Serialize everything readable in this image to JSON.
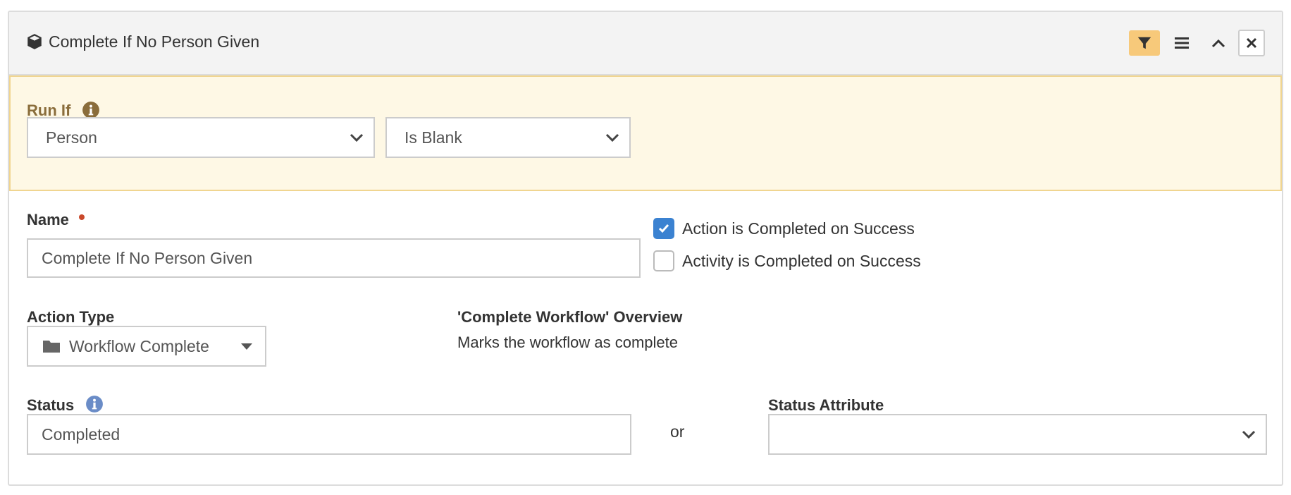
{
  "header": {
    "title": "Complete If No Person Given",
    "icon": "cube-icon",
    "buttons": [
      "filter-icon",
      "menu-icon",
      "chevron-up-icon",
      "close-icon"
    ],
    "filter_active_color": "#f7c97a"
  },
  "run_if": {
    "label": "Run If",
    "field_select": {
      "value": "Person"
    },
    "comparison_select": {
      "value": "Is Blank"
    },
    "background_color": "#fef8e5",
    "label_color": "#8a6d3b"
  },
  "name": {
    "label": "Name",
    "required": true,
    "value": "Complete If No Person Given"
  },
  "options": {
    "action_completed": {
      "label": "Action is Completed on Success",
      "checked": true
    },
    "activity_completed": {
      "label": "Activity is Completed on Success",
      "checked": false
    }
  },
  "action_type": {
    "label": "Action Type",
    "value": "Workflow Complete",
    "icon": "folder-icon"
  },
  "overview": {
    "title": "'Complete Workflow' Overview",
    "description": "Marks the workflow as complete"
  },
  "status": {
    "label": "Status",
    "value": "Completed",
    "or_text": "or"
  },
  "status_attribute": {
    "label": "Status Attribute",
    "value": ""
  },
  "colors": {
    "checkbox_checked": "#3b82d1",
    "required_dot": "#c9482b",
    "info_blue": "#6a8cc7"
  }
}
